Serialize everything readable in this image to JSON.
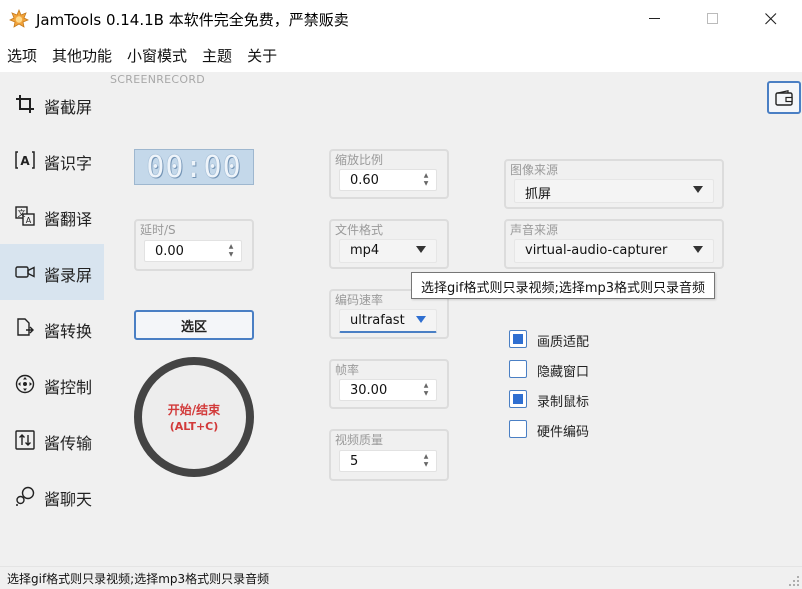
{
  "window": {
    "title": "JamTools 0.14.1B 本软件完全免费，严禁贩卖"
  },
  "menu": [
    "选项",
    "其他功能",
    "小窗模式",
    "主题",
    "关于"
  ],
  "sidebar": {
    "items": [
      {
        "label": "酱截屏",
        "icon": "crop-icon"
      },
      {
        "label": "酱识字",
        "icon": "text-recognition-icon"
      },
      {
        "label": "酱翻译",
        "icon": "translate-icon"
      },
      {
        "label": "酱录屏",
        "icon": "video-camera-icon",
        "active": true
      },
      {
        "label": "酱转换",
        "icon": "file-convert-icon"
      },
      {
        "label": "酱控制",
        "icon": "remote-control-icon"
      },
      {
        "label": "酱传输",
        "icon": "transfer-icon"
      },
      {
        "label": "酱聊天",
        "icon": "chat-icon"
      }
    ]
  },
  "record": {
    "section_label": "SCREENRECORD",
    "timer": "00:00",
    "delay": {
      "title": "延时/S",
      "value": "0.00"
    },
    "select_area_label": "选区",
    "start_stop": {
      "line1": "开始/结束",
      "line2": "(ALT+C)"
    },
    "scale": {
      "title": "缩放比例",
      "value": "0.60"
    },
    "format": {
      "title": "文件格式",
      "value": "mp4"
    },
    "encode_speed": {
      "title": "编码速率",
      "value": "ultrafast"
    },
    "fps": {
      "title": "帧率",
      "value": "30.00"
    },
    "quality": {
      "title": "视频质量",
      "value": "5"
    },
    "image_source": {
      "title": "图像来源",
      "value": "抓屏"
    },
    "audio_source": {
      "title": "声音来源",
      "value": "virtual-audio-capturer"
    },
    "options": [
      {
        "label": "画质适配",
        "checked": true
      },
      {
        "label": "隐藏窗口",
        "checked": false
      },
      {
        "label": "录制鼠标",
        "checked": true
      },
      {
        "label": "硬件编码",
        "checked": false
      }
    ],
    "tooltip": "选择gif格式则只录视频;选择mp3格式则只录音频"
  },
  "status": {
    "text": "选择gif格式则只录视频;选择mp3格式则只录音频"
  },
  "colors": {
    "accent": "#4a7fc4",
    "checkbox_fill": "#2f6fd1",
    "record_text": "#d23a3a",
    "active_sidebar": "#d8e4ef"
  }
}
